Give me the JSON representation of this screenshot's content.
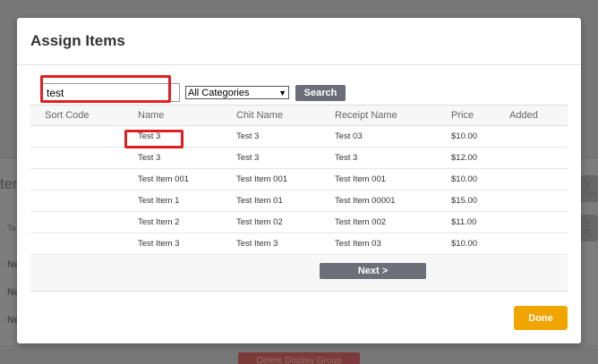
{
  "background": {
    "heading_fragment": "ten",
    "row_label": "Ta",
    "rows": [
      "Ne",
      "Ne",
      "Ne"
    ],
    "side_button_1": "y Gr",
    "side_button_2": "y C",
    "danger_button": "Delete Display Group"
  },
  "modal": {
    "title": "Assign Items",
    "search": {
      "value": "test",
      "category_selected": "All Categories",
      "button_label": "Search"
    },
    "table": {
      "headers": [
        "Sort Code",
        "Name",
        "Chit Name",
        "Receipt Name",
        "Price",
        "Added"
      ],
      "rows": [
        {
          "sort_code": "",
          "name": "Test 3",
          "chit_name": "Test 3",
          "receipt_name": "Test 03",
          "price": "$10.00",
          "added": ""
        },
        {
          "sort_code": "",
          "name": "Test 3",
          "chit_name": "Test 3",
          "receipt_name": "Test 3",
          "price": "$12.00",
          "added": ""
        },
        {
          "sort_code": "",
          "name": "Test Item 001",
          "chit_name": "Test Item 001",
          "receipt_name": "Test Item 001",
          "price": "$10.00",
          "added": ""
        },
        {
          "sort_code": "",
          "name": "Test Item 1",
          "chit_name": "Test Item 01",
          "receipt_name": "Test Item 00001",
          "price": "$15.00",
          "added": ""
        },
        {
          "sort_code": "",
          "name": "Test Item 2",
          "chit_name": "Test Item 02",
          "receipt_name": "Test Item 002",
          "price": "$11.00",
          "added": ""
        },
        {
          "sort_code": "",
          "name": "Test Item 3",
          "chit_name": "Test Item 3",
          "receipt_name": "Test Item 03",
          "price": "$10.00",
          "added": ""
        }
      ]
    },
    "next_label": "Next >",
    "done_label": "Done"
  },
  "colors": {
    "accent_done": "#f0a500",
    "button_gray": "#6d6e78",
    "highlight_red": "#e02020"
  }
}
